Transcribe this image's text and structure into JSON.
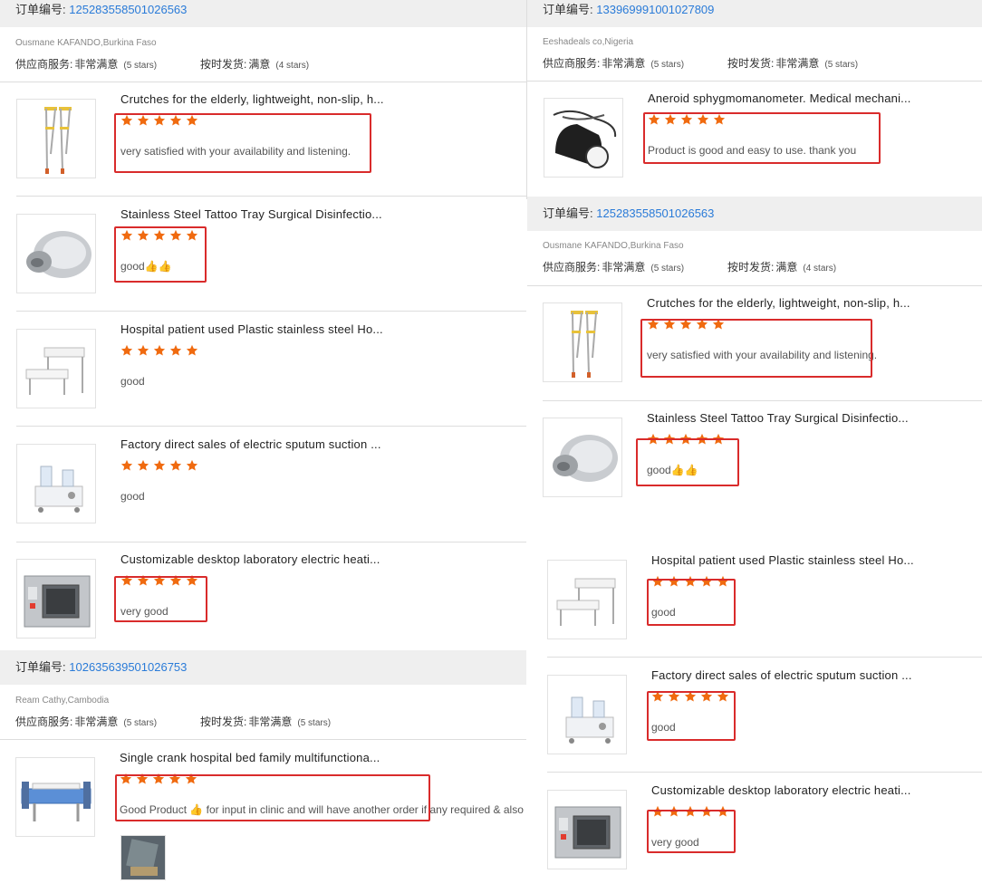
{
  "labels": {
    "order_prefix": "订单编号:",
    "supplier_service": "供应商服务:",
    "on_time_shipping": "按时发货:"
  },
  "colors": {
    "star": "#f06a0f",
    "highlight": "#d92b2b",
    "order_link": "#2a7bd8"
  },
  "left": {
    "order1": {
      "order_no": "125283558501026563",
      "buyer": "Ousmane KAFANDO,Burkina Faso",
      "supplier_value": "非常满意",
      "supplier_stars": "(5 stars)",
      "shipping_value": "满意",
      "shipping_stars": "(4 stars)",
      "items": [
        {
          "title": "Crutches for the elderly, lightweight, non-slip, h...",
          "rating": 5,
          "comment": "very satisfied with your availability and listening.",
          "thumb": "crutches-image"
        },
        {
          "title": "Stainless Steel Tattoo Tray Surgical Disinfectio...",
          "rating": 5,
          "comment": "good",
          "thumb": "tray-image"
        },
        {
          "title": "Hospital patient used Plastic stainless steel Ho...",
          "rating": 5,
          "comment": "good",
          "thumb": "step-stool-image"
        },
        {
          "title": "Factory direct sales of electric sputum suction ...",
          "rating": 5,
          "comment": "good",
          "thumb": "suction-machine-image"
        },
        {
          "title": "Customizable desktop laboratory electric heati...",
          "rating": 5,
          "comment": "very good",
          "thumb": "incubator-image"
        }
      ]
    },
    "order2": {
      "order_no": "102635639501026753",
      "buyer": "Ream Cathy,Cambodia",
      "supplier_value": "非常满意",
      "supplier_stars": "(5 stars)",
      "shipping_value": "非常满意",
      "shipping_stars": "(5 stars)",
      "items": [
        {
          "title": "Single crank hospital bed family multifunctiona...",
          "rating": 5,
          "comment_a": "Good Product ",
          "comment_b": " for input in clinic and will have another order if any required & also",
          "thumb": "hospital-bed-image"
        }
      ]
    }
  },
  "right": {
    "order1": {
      "order_no": "133969991001027809",
      "buyer": "Eeshadeals co,Nigeria",
      "supplier_value": "非常满意",
      "supplier_stars": "(5 stars)",
      "shipping_value": "非常满意",
      "shipping_stars": "(5 stars)",
      "items": [
        {
          "title": "Aneroid sphygmomanometer. Medical mechani...",
          "rating": 5,
          "comment": "Product is good and easy to use. thank you",
          "thumb": "sphygmomanometer-image"
        }
      ]
    },
    "order2": {
      "order_no": "125283558501026563",
      "buyer": "Ousmane KAFANDO,Burkina Faso",
      "supplier_value": "非常满意",
      "supplier_stars": "(5 stars)",
      "shipping_value": "满意",
      "shipping_stars": "(4 stars)",
      "items": [
        {
          "title": "Crutches for the elderly, lightweight, non-slip, h...",
          "rating": 5,
          "comment": "very satisfied with your availability and listening.",
          "thumb": "crutches-image"
        },
        {
          "title": "Stainless Steel Tattoo Tray Surgical Disinfectio...",
          "rating": 5,
          "comment": "good",
          "thumb": "tray-image"
        }
      ]
    },
    "order3": {
      "items": [
        {
          "title": "Hospital patient used Plastic stainless steel Ho...",
          "rating": 5,
          "comment": "good",
          "thumb": "step-stool-image"
        },
        {
          "title": "Factory direct sales of electric sputum suction ...",
          "rating": 5,
          "comment": "good",
          "thumb": "suction-machine-image"
        },
        {
          "title": "Customizable desktop laboratory electric heati...",
          "rating": 5,
          "comment": "very good",
          "thumb": "incubator-image"
        }
      ]
    }
  }
}
